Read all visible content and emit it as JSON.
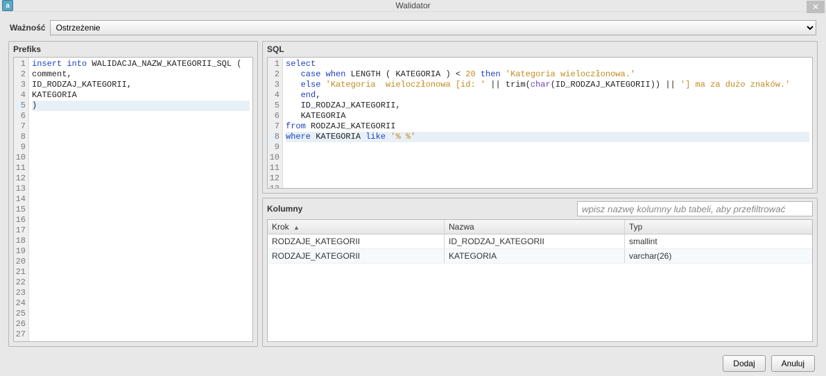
{
  "window": {
    "title": "Walidator"
  },
  "severity": {
    "label": "Ważność",
    "value": "Ostrzeżenie",
    "options": [
      "Ostrzeżenie"
    ]
  },
  "prefix": {
    "title": "Prefiks",
    "total_lines": 27,
    "highlight_line": 5,
    "lines": [
      {
        "n": 1,
        "tokens": [
          {
            "t": "insert into",
            "c": "kw"
          },
          {
            "t": " WALIDACJA_NAZW_KATEGORII_SQL ("
          }
        ]
      },
      {
        "n": 2,
        "tokens": [
          {
            "t": "comment,"
          }
        ]
      },
      {
        "n": 3,
        "tokens": [
          {
            "t": "ID_RODZAJ_KATEGORII,"
          }
        ]
      },
      {
        "n": 4,
        "tokens": [
          {
            "t": "KATEGORIA"
          }
        ]
      },
      {
        "n": 5,
        "tokens": [
          {
            "t": ")"
          }
        ]
      }
    ]
  },
  "sql": {
    "title": "SQL",
    "total_lines": 13,
    "highlight_line": 8,
    "lines": [
      {
        "n": 1,
        "tokens": [
          {
            "t": "select",
            "c": "kw"
          }
        ]
      },
      {
        "n": 2,
        "tokens": [
          {
            "t": "   "
          },
          {
            "t": "case when",
            "c": "kw"
          },
          {
            "t": " LENGTH ( KATEGORIA ) < "
          },
          {
            "t": "20",
            "c": "num"
          },
          {
            "t": " "
          },
          {
            "t": "then",
            "c": "kw"
          },
          {
            "t": " "
          },
          {
            "t": "'Kategoria wieloczłonowa.'",
            "c": "str"
          }
        ]
      },
      {
        "n": 3,
        "tokens": [
          {
            "t": "   "
          },
          {
            "t": "else",
            "c": "kw"
          },
          {
            "t": " "
          },
          {
            "t": "'Kategoria  wieloczłonowa [id: '",
            "c": "str"
          },
          {
            "t": " || trim("
          },
          {
            "t": "char",
            "c": "fn"
          },
          {
            "t": "(ID_RODZAJ_KATEGORII)) || "
          },
          {
            "t": "'] ma za dużo znaków.'",
            "c": "str"
          }
        ]
      },
      {
        "n": 4,
        "tokens": [
          {
            "t": "   "
          },
          {
            "t": "end",
            "c": "kw"
          },
          {
            "t": ","
          }
        ]
      },
      {
        "n": 5,
        "tokens": [
          {
            "t": "   ID_RODZAJ_KATEGORII,"
          }
        ]
      },
      {
        "n": 6,
        "tokens": [
          {
            "t": "   KATEGORIA"
          }
        ]
      },
      {
        "n": 7,
        "tokens": [
          {
            "t": "from",
            "c": "kw"
          },
          {
            "t": " RODZAJE_KATEGORII"
          }
        ]
      },
      {
        "n": 8,
        "tokens": [
          {
            "t": "where",
            "c": "kw"
          },
          {
            "t": " KATEGORIA "
          },
          {
            "t": "like",
            "c": "kw"
          },
          {
            "t": " "
          },
          {
            "t": "'% %'",
            "c": "str"
          }
        ]
      }
    ]
  },
  "columns": {
    "title": "Kolumny",
    "filter_placeholder": "wpisz nazwę kolumny lub tabeli, aby przefiltrować",
    "headers": {
      "krok": "Krok",
      "nazwa": "Nazwa",
      "typ": "Typ",
      "sort_indicator": "▲"
    },
    "rows": [
      {
        "krok": "RODZAJE_KATEGORII",
        "nazwa": "ID_RODZAJ_KATEGORII",
        "typ": "smallint"
      },
      {
        "krok": "RODZAJE_KATEGORII",
        "nazwa": "KATEGORIA",
        "typ": "varchar(26)"
      }
    ]
  },
  "buttons": {
    "add": "Dodaj",
    "cancel": "Anuluj"
  },
  "icons": {
    "close": "✕",
    "app_letter": "a"
  }
}
